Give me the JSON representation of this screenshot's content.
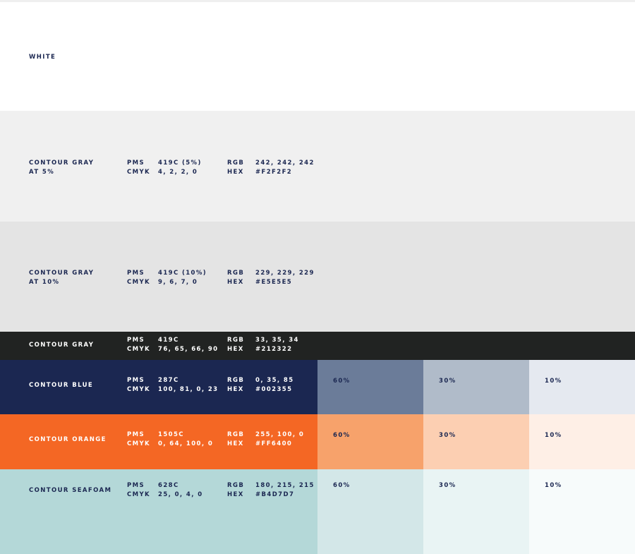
{
  "labels": {
    "pms": "PMS",
    "cmyk": "CMYK",
    "rgb": "RGB",
    "hex": "HEX"
  },
  "swatches": [
    {
      "name": "WHITE",
      "bg": "#FFFFFF"
    },
    {
      "name_line1": "CONTOUR GRAY",
      "name_line2": "AT 5%",
      "pms": "419C (5%)",
      "cmyk": "4, 2, 2, 0",
      "rgb": "242, 242, 242",
      "hex": "#F2F2F2",
      "bg": "#F0F0F0"
    },
    {
      "name_line1": "CONTOUR GRAY",
      "name_line2": "AT 10%",
      "pms": "419C (10%)",
      "cmyk": "9, 6, 7, 0",
      "rgb": "229, 229, 229",
      "hex": "#E5E5E5",
      "bg": "#E4E4E4"
    },
    {
      "name": "CONTOUR GRAY",
      "pms": "419C",
      "cmyk": "76, 65, 66, 90",
      "rgb": "33, 35, 34",
      "hex": "#212322",
      "bg": "#212322"
    },
    {
      "name": "CONTOUR BLUE",
      "pms": "287C",
      "cmyk": "100, 81, 0, 23",
      "rgb": "0, 35, 85",
      "hex": "#002355",
      "bg": "#1B2751",
      "tints": [
        {
          "label": "60%",
          "color": "#6B7C99"
        },
        {
          "label": "30%",
          "color": "#B0BBC9"
        },
        {
          "label": "10%",
          "color": "#E5E9F0"
        }
      ]
    },
    {
      "name": "CONTOUR ORANGE",
      "pms": "1505C",
      "cmyk": "0, 64, 100, 0",
      "rgb": "255, 100, 0",
      "hex": "#FF6400",
      "bg": "#F46724",
      "tints": [
        {
          "label": "60%",
          "color": "#F7A26B"
        },
        {
          "label": "30%",
          "color": "#FCCFB2"
        },
        {
          "label": "10%",
          "color": "#FEEFE6"
        }
      ]
    },
    {
      "name": "CONTOUR SEAFOAM",
      "pms": "628C",
      "cmyk": "25, 0, 4, 0",
      "rgb": "180, 215, 215",
      "hex": "#B4D7D7",
      "bg": "#B4D8D8",
      "tints": [
        {
          "label": "60%",
          "color": "#D3E7E8"
        },
        {
          "label": "30%",
          "color": "#E9F4F4"
        },
        {
          "label": "10%",
          "color": "#F7FBFB"
        }
      ]
    }
  ]
}
